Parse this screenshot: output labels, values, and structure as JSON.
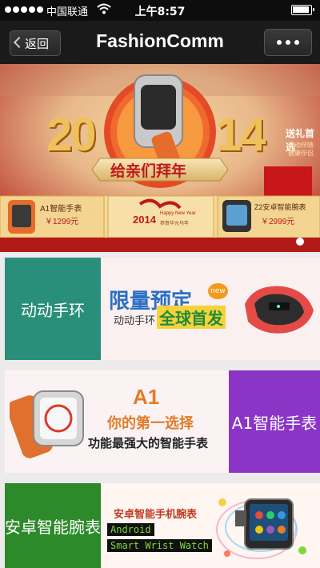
{
  "status_bar": {
    "carrier": "中国联通",
    "time": "上午8:57"
  },
  "nav": {
    "back_label": "返回",
    "title": "FashionComm"
  },
  "banner": {
    "year_left": "20",
    "year_right": "14",
    "greeting": "给亲们拜年",
    "gift_title": "送礼首选",
    "gift_sub1": "运动伴随",
    "gift_sub2": "健康伴侣",
    "product_left_name": "A1智能手表",
    "product_left_price": "￥1299元",
    "newyear_year": "2014",
    "newyear_text": "Happy New Year",
    "newyear_sub": "恭贺华元马年",
    "product_right_name": "Z2安卓智能腕表",
    "product_right_price": "￥2999元"
  },
  "cards": [
    {
      "tile_label": "动动手环",
      "tile_color": "#2a8f7a",
      "promo_line1": "限量预定",
      "promo_line2": "全球首发",
      "promo_sub": "动动手环",
      "promo_badge": "new"
    },
    {
      "tile_label": "A1智能手表",
      "tile_color": "#8b35c6",
      "promo_title": "A1",
      "promo_line1": "你的第一选择",
      "promo_line2": "功能最强大的智能手表"
    },
    {
      "tile_label": "安卓智能腕表",
      "tile_color": "#2d8a2a",
      "promo_title": "安卓智能手机腕表",
      "promo_tag1": "Android",
      "promo_tag2": "Smart Wrist Watch"
    }
  ]
}
